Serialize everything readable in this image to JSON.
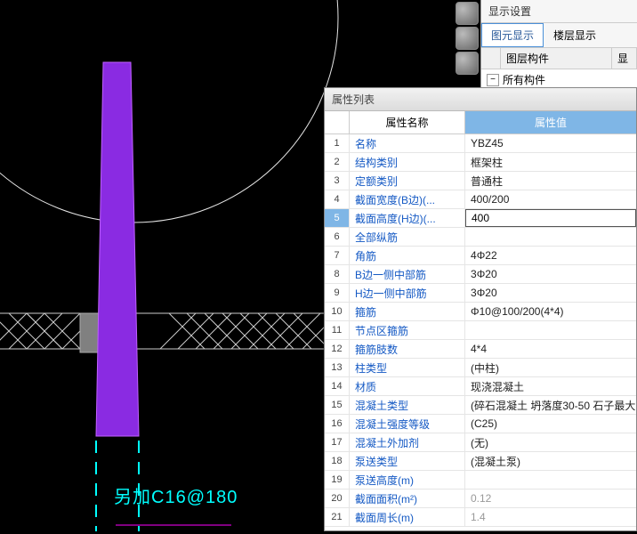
{
  "displaySettings": {
    "title": "显示设置",
    "tabs": {
      "element": "图元显示",
      "floor": "楼层显示"
    },
    "layerHeader": {
      "component": "图层构件",
      "display": "显"
    },
    "rows": [
      {
        "label": "所有构件"
      }
    ]
  },
  "annotation": {
    "text": "另加C16@180"
  },
  "propertyPanel": {
    "title": "属性列表",
    "headers": {
      "name": "属性名称",
      "value": "属性值"
    },
    "rows": [
      {
        "n": "1",
        "name": "名称",
        "value": "YBZ45"
      },
      {
        "n": "2",
        "name": "结构类别",
        "value": "框架柱"
      },
      {
        "n": "3",
        "name": "定额类别",
        "value": "普通柱"
      },
      {
        "n": "4",
        "name": "截面宽度(B边)(...",
        "value": "400/200"
      },
      {
        "n": "5",
        "name": "截面高度(H边)(...",
        "value": "400",
        "editing": true
      },
      {
        "n": "6",
        "name": "全部纵筋",
        "value": ""
      },
      {
        "n": "7",
        "name": "角筋",
        "value": "4Φ22"
      },
      {
        "n": "8",
        "name": "B边一侧中部筋",
        "value": "3Φ20"
      },
      {
        "n": "9",
        "name": "H边一侧中部筋",
        "value": "3Φ20"
      },
      {
        "n": "10",
        "name": "箍筋",
        "value": "Φ10@100/200(4*4)"
      },
      {
        "n": "11",
        "name": "节点区箍筋",
        "value": ""
      },
      {
        "n": "12",
        "name": "箍筋肢数",
        "value": "4*4"
      },
      {
        "n": "13",
        "name": "柱类型",
        "value": "(中柱)"
      },
      {
        "n": "14",
        "name": "材质",
        "value": "现浇混凝土"
      },
      {
        "n": "15",
        "name": "混凝土类型",
        "value": "(碎石混凝土 坍落度30-50 石子最大..."
      },
      {
        "n": "16",
        "name": "混凝土强度等级",
        "value": "(C25)"
      },
      {
        "n": "17",
        "name": "混凝土外加剂",
        "value": "(无)"
      },
      {
        "n": "18",
        "name": "泵送类型",
        "value": "(混凝土泵)"
      },
      {
        "n": "19",
        "name": "泵送高度(m)",
        "value": ""
      },
      {
        "n": "20",
        "name": "截面面积(m²)",
        "value": "0.12",
        "readonly": true
      },
      {
        "n": "21",
        "name": "截面周长(m)",
        "value": "1.4",
        "readonly": true
      }
    ]
  }
}
